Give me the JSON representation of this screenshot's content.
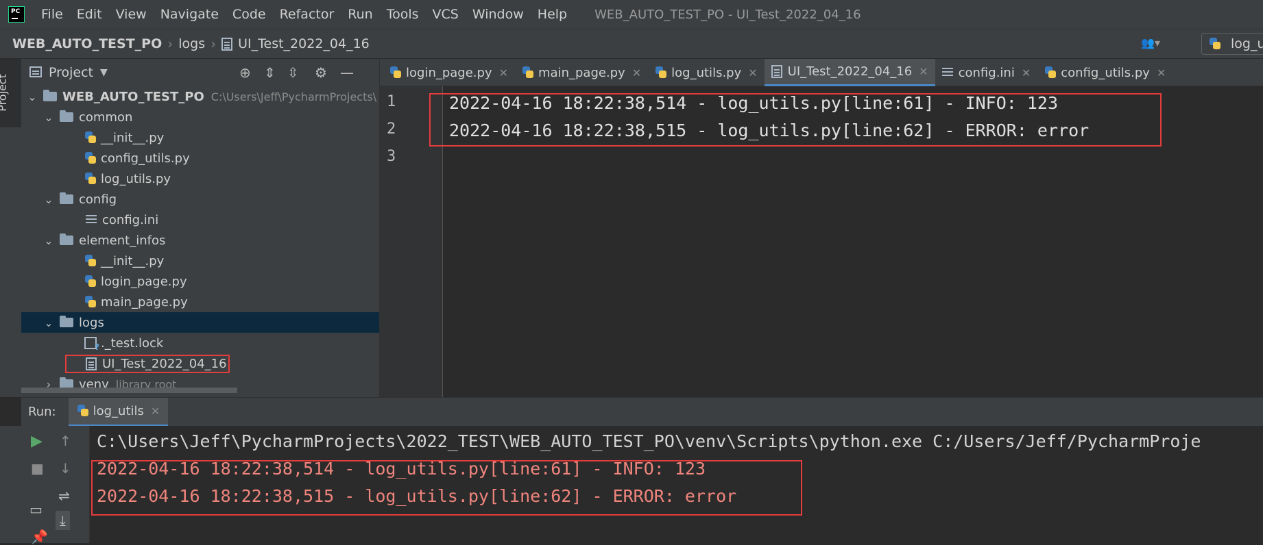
{
  "menubar": {
    "items": [
      "File",
      "Edit",
      "View",
      "Navigate",
      "Code",
      "Refactor",
      "Run",
      "Tools",
      "VCS",
      "Window",
      "Help"
    ],
    "window_title": "WEB_AUTO_TEST_PO - UI_Test_2022_04_16"
  },
  "breadcrumb": {
    "project": "WEB_AUTO_TEST_PO",
    "folder": "logs",
    "file": "UI_Test_2022_04_16"
  },
  "run_config": {
    "label": "log_u"
  },
  "left_strip": {
    "project_tab": "Project"
  },
  "project_panel": {
    "title": "Project",
    "tree": [
      {
        "label": "WEB_AUTO_TEST_PO",
        "hint": "C:\\Users\\Jeff\\PycharmProjects\\"
      },
      {
        "label": "common"
      },
      {
        "label": "__init__.py"
      },
      {
        "label": "config_utils.py"
      },
      {
        "label": "log_utils.py"
      },
      {
        "label": "config"
      },
      {
        "label": "config.ini"
      },
      {
        "label": "element_infos"
      },
      {
        "label": "__init__.py"
      },
      {
        "label": "login_page.py"
      },
      {
        "label": "main_page.py"
      },
      {
        "label": "logs"
      },
      {
        "label": "._test.lock"
      },
      {
        "label": "UI_Test_2022_04_16"
      },
      {
        "label": "venv",
        "hint": "library root"
      }
    ]
  },
  "editor": {
    "tabs": [
      {
        "label": "login_page.py",
        "icon": "python-file-icon"
      },
      {
        "label": "main_page.py",
        "icon": "python-file-icon"
      },
      {
        "label": "log_utils.py",
        "icon": "python-file-icon"
      },
      {
        "label": "UI_Test_2022_04_16",
        "icon": "text-file-icon",
        "active": true
      },
      {
        "label": "config.ini",
        "icon": "ini-file-icon"
      },
      {
        "label": "config_utils.py",
        "icon": "python-file-icon"
      }
    ],
    "line_numbers": [
      "1",
      "2",
      "3"
    ],
    "lines": [
      "2022-04-16 18:22:38,514 - log_utils.py[line:61] - INFO: 123",
      "2022-04-16 18:22:38,515 - log_utils.py[line:62] - ERROR: error",
      ""
    ]
  },
  "run": {
    "label": "Run:",
    "tab": "log_utils",
    "console": [
      {
        "text": "C:\\Users\\Jeff\\PycharmProjects\\2022_TEST\\WEB_AUTO_TEST_PO\\venv\\Scripts\\python.exe C:/Users/Jeff/PycharmProje",
        "color": "#d4d4d4"
      },
      {
        "text": "2022-04-16 18:22:38,514 - log_utils.py[line:61] - INFO: 123",
        "color": "#f0857d"
      },
      {
        "text": "2022-04-16 18:22:38,515 - log_utils.py[line:62] - ERROR: error",
        "color": "#f0857d"
      }
    ]
  },
  "colors": {
    "highlight_box": "#e53c3c",
    "accent": "#4a88c7",
    "error_text": "#f0857d"
  }
}
